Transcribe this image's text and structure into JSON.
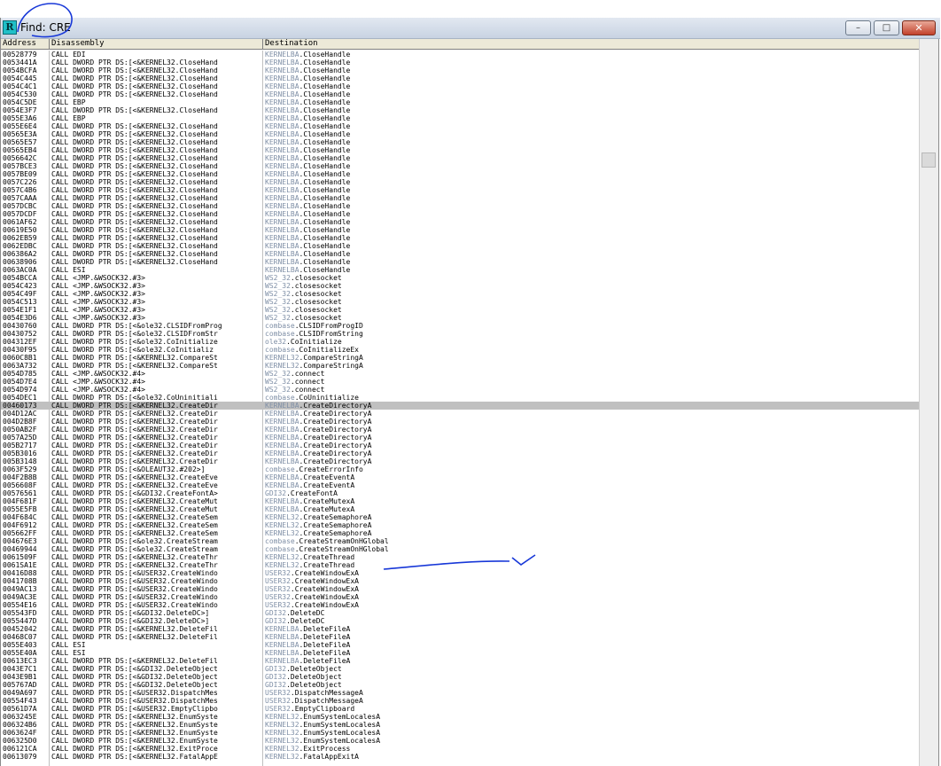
{
  "window": {
    "title": "Find: CRE",
    "app_icon_letter": "R",
    "controls": {
      "minimize": "–",
      "maximize": "□",
      "close": "✕"
    }
  },
  "columns": [
    "Address",
    "Disassembly",
    "Destination"
  ],
  "selected_row": 44,
  "rows": [
    {
      "addr": "00528779",
      "dis": "CALL EDI",
      "mod": "KERNELBA",
      "fn": ".CloseHandle"
    },
    {
      "addr": "0053441A",
      "dis": "CALL DWORD PTR DS:[<&KERNEL32.CloseHand",
      "mod": "KERNELBA",
      "fn": ".CloseHandle"
    },
    {
      "addr": "0054BCFA",
      "dis": "CALL DWORD PTR DS:[<&KERNEL32.CloseHand",
      "mod": "KERNELBA",
      "fn": ".CloseHandle"
    },
    {
      "addr": "0054C445",
      "dis": "CALL DWORD PTR DS:[<&KERNEL32.CloseHand",
      "mod": "KERNELBA",
      "fn": ".CloseHandle"
    },
    {
      "addr": "0054C4C1",
      "dis": "CALL DWORD PTR DS:[<&KERNEL32.CloseHand",
      "mod": "KERNELBA",
      "fn": ".CloseHandle"
    },
    {
      "addr": "0054C530",
      "dis": "CALL DWORD PTR DS:[<&KERNEL32.CloseHand",
      "mod": "KERNELBA",
      "fn": ".CloseHandle"
    },
    {
      "addr": "0054C5DE",
      "dis": "CALL EBP",
      "mod": "KERNELBA",
      "fn": ".CloseHandle"
    },
    {
      "addr": "0054E3F7",
      "dis": "CALL DWORD PTR DS:[<&KERNEL32.CloseHand",
      "mod": "KERNELBA",
      "fn": ".CloseHandle"
    },
    {
      "addr": "0055E3A6",
      "dis": "CALL EBP",
      "mod": "KERNELBA",
      "fn": ".CloseHandle"
    },
    {
      "addr": "0055E6E4",
      "dis": "CALL DWORD PTR DS:[<&KERNEL32.CloseHand",
      "mod": "KERNELBA",
      "fn": ".CloseHandle"
    },
    {
      "addr": "00565E3A",
      "dis": "CALL DWORD PTR DS:[<&KERNEL32.CloseHand",
      "mod": "KERNELBA",
      "fn": ".CloseHandle"
    },
    {
      "addr": "00565E57",
      "dis": "CALL DWORD PTR DS:[<&KERNEL32.CloseHand",
      "mod": "KERNELBA",
      "fn": ".CloseHandle"
    },
    {
      "addr": "00565EB4",
      "dis": "CALL DWORD PTR DS:[<&KERNEL32.CloseHand",
      "mod": "KERNELBA",
      "fn": ".CloseHandle"
    },
    {
      "addr": "0056642C",
      "dis": "CALL DWORD PTR DS:[<&KERNEL32.CloseHand",
      "mod": "KERNELBA",
      "fn": ".CloseHandle"
    },
    {
      "addr": "0057BCE3",
      "dis": "CALL DWORD PTR DS:[<&KERNEL32.CloseHand",
      "mod": "KERNELBA",
      "fn": ".CloseHandle"
    },
    {
      "addr": "0057BE09",
      "dis": "CALL DWORD PTR DS:[<&KERNEL32.CloseHand",
      "mod": "KERNELBA",
      "fn": ".CloseHandle"
    },
    {
      "addr": "0057C226",
      "dis": "CALL DWORD PTR DS:[<&KERNEL32.CloseHand",
      "mod": "KERNELBA",
      "fn": ".CloseHandle"
    },
    {
      "addr": "0057C4B6",
      "dis": "CALL DWORD PTR DS:[<&KERNEL32.CloseHand",
      "mod": "KERNELBA",
      "fn": ".CloseHandle"
    },
    {
      "addr": "0057CAAA",
      "dis": "CALL DWORD PTR DS:[<&KERNEL32.CloseHand",
      "mod": "KERNELBA",
      "fn": ".CloseHandle"
    },
    {
      "addr": "0057DCBC",
      "dis": "CALL DWORD PTR DS:[<&KERNEL32.CloseHand",
      "mod": "KERNELBA",
      "fn": ".CloseHandle"
    },
    {
      "addr": "0057DCDF",
      "dis": "CALL DWORD PTR DS:[<&KERNEL32.CloseHand",
      "mod": "KERNELBA",
      "fn": ".CloseHandle"
    },
    {
      "addr": "0061AF62",
      "dis": "CALL DWORD PTR DS:[<&KERNEL32.CloseHand",
      "mod": "KERNELBA",
      "fn": ".CloseHandle"
    },
    {
      "addr": "00619E50",
      "dis": "CALL DWORD PTR DS:[<&KERNEL32.CloseHand",
      "mod": "KERNELBA",
      "fn": ".CloseHandle"
    },
    {
      "addr": "0062EB59",
      "dis": "CALL DWORD PTR DS:[<&KERNEL32.CloseHand",
      "mod": "KERNELBA",
      "fn": ".CloseHandle"
    },
    {
      "addr": "0062EDBC",
      "dis": "CALL DWORD PTR DS:[<&KERNEL32.CloseHand",
      "mod": "KERNELBA",
      "fn": ".CloseHandle"
    },
    {
      "addr": "006386A2",
      "dis": "CALL DWORD PTR DS:[<&KERNEL32.CloseHand",
      "mod": "KERNELBA",
      "fn": ".CloseHandle"
    },
    {
      "addr": "00638906",
      "dis": "CALL DWORD PTR DS:[<&KERNEL32.CloseHand",
      "mod": "KERNELBA",
      "fn": ".CloseHandle"
    },
    {
      "addr": "0063AC0A",
      "dis": "CALL ESI",
      "mod": "KERNELBA",
      "fn": ".CloseHandle"
    },
    {
      "addr": "0054BCCA",
      "dis": "CALL <JMP.&WSOCK32.#3>",
      "mod": "WS2_32",
      "fn": ".closesocket"
    },
    {
      "addr": "0054C423",
      "dis": "CALL <JMP.&WSOCK32.#3>",
      "mod": "WS2_32",
      "fn": ".closesocket"
    },
    {
      "addr": "0054C49F",
      "dis": "CALL <JMP.&WSOCK32.#3>",
      "mod": "WS2_32",
      "fn": ".closesocket"
    },
    {
      "addr": "0054C513",
      "dis": "CALL <JMP.&WSOCK32.#3>",
      "mod": "WS2_32",
      "fn": ".closesocket"
    },
    {
      "addr": "0054E1F1",
      "dis": "CALL <JMP.&WSOCK32.#3>",
      "mod": "WS2_32",
      "fn": ".closesocket"
    },
    {
      "addr": "0054E3D6",
      "dis": "CALL <JMP.&WSOCK32.#3>",
      "mod": "WS2_32",
      "fn": ".closesocket"
    },
    {
      "addr": "00430760",
      "dis": "CALL DWORD PTR DS:[<&ole32.CLSIDFromProg",
      "mod": "combase",
      "fn": ".CLSIDFromProgID"
    },
    {
      "addr": "00430752",
      "dis": "CALL DWORD PTR DS:[<&ole32.CLSIDFromStr",
      "mod": "combase",
      "fn": ".CLSIDFromString"
    },
    {
      "addr": "004312EF",
      "dis": "CALL DWORD PTR DS:[<&ole32.CoInitialize",
      "mod": "ole32",
      "fn": ".CoInitialize"
    },
    {
      "addr": "00430F95",
      "dis": "CALL DWORD PTR DS:[<&ole32.CoInitializ",
      "mod": "combase",
      "fn": ".CoInitializeEx"
    },
    {
      "addr": "0060C8B1",
      "dis": "CALL DWORD PTR DS:[<&KERNEL32.CompareSt",
      "mod": "KERNEL32",
      "fn": ".CompareStringA"
    },
    {
      "addr": "0063A732",
      "dis": "CALL DWORD PTR DS:[<&KERNEL32.CompareSt",
      "mod": "KERNEL32",
      "fn": ".CompareStringA"
    },
    {
      "addr": "0054D785",
      "dis": "CALL <JMP.&WSOCK32.#4>",
      "mod": "WS2_32",
      "fn": ".connect"
    },
    {
      "addr": "0054D7E4",
      "dis": "CALL <JMP.&WSOCK32.#4>",
      "mod": "WS2_32",
      "fn": ".connect"
    },
    {
      "addr": "0054D974",
      "dis": "CALL <JMP.&WSOCK32.#4>",
      "mod": "WS2_32",
      "fn": ".connect"
    },
    {
      "addr": "0054DEC1",
      "dis": "CALL DWORD PTR DS:[<&ole32.CoUninitiali",
      "mod": "combase",
      "fn": ".CoUninitialize"
    },
    {
      "addr": "00460173",
      "dis": "CALL DWORD PTR DS:[<&KERNEL32.CreateDir",
      "mod": "KERNELBA",
      "fn": ".CreateDirectoryA"
    },
    {
      "addr": "004D12AC",
      "dis": "CALL DWORD PTR DS:[<&KERNEL32.CreateDir",
      "mod": "KERNELBA",
      "fn": ".CreateDirectoryA"
    },
    {
      "addr": "004D2B8F",
      "dis": "CALL DWORD PTR DS:[<&KERNEL32.CreateDir",
      "mod": "KERNELBA",
      "fn": ".CreateDirectoryA"
    },
    {
      "addr": "0050AB2F",
      "dis": "CALL DWORD PTR DS:[<&KERNEL32.CreateDir",
      "mod": "KERNELBA",
      "fn": ".CreateDirectoryA"
    },
    {
      "addr": "0057A25D",
      "dis": "CALL DWORD PTR DS:[<&KERNEL32.CreateDir",
      "mod": "KERNELBA",
      "fn": ".CreateDirectoryA"
    },
    {
      "addr": "005B2717",
      "dis": "CALL DWORD PTR DS:[<&KERNEL32.CreateDir",
      "mod": "KERNELBA",
      "fn": ".CreateDirectoryA"
    },
    {
      "addr": "005B3016",
      "dis": "CALL DWORD PTR DS:[<&KERNEL32.CreateDir",
      "mod": "KERNELBA",
      "fn": ".CreateDirectoryA"
    },
    {
      "addr": "005B3148",
      "dis": "CALL DWORD PTR DS:[<&KERNEL32.CreateDir",
      "mod": "KERNELBA",
      "fn": ".CreateDirectoryA"
    },
    {
      "addr": "0063F529",
      "dis": "CALL DWORD PTR DS:[<&OLEAUT32.#202>]",
      "mod": "combase",
      "fn": ".CreateErrorInfo"
    },
    {
      "addr": "004F2B8B",
      "dis": "CALL DWORD PTR DS:[<&KERNEL32.CreateEve",
      "mod": "KERNELBA",
      "fn": ".CreateEventA"
    },
    {
      "addr": "0056608F",
      "dis": "CALL DWORD PTR DS:[<&KERNEL32.CreateEve",
      "mod": "KERNELBA",
      "fn": ".CreateEventA"
    },
    {
      "addr": "00576561",
      "dis": "CALL DWORD PTR DS:[<&GDI32.CreateFontA>",
      "mod": "GDI32",
      "fn": ".CreateFontA"
    },
    {
      "addr": "004F681F",
      "dis": "CALL DWORD PTR DS:[<&KERNEL32.CreateMut",
      "mod": "KERNELBA",
      "fn": ".CreateMutexA"
    },
    {
      "addr": "0055E5FB",
      "dis": "CALL DWORD PTR DS:[<&KERNEL32.CreateMut",
      "mod": "KERNELBA",
      "fn": ".CreateMutexA"
    },
    {
      "addr": "004F684C",
      "dis": "CALL DWORD PTR DS:[<&KERNEL32.CreateSem",
      "mod": "KERNEL32",
      "fn": ".CreateSemaphoreA"
    },
    {
      "addr": "004F6912",
      "dis": "CALL DWORD PTR DS:[<&KERNEL32.CreateSem",
      "mod": "KERNEL32",
      "fn": ".CreateSemaphoreA"
    },
    {
      "addr": "005662FF",
      "dis": "CALL DWORD PTR DS:[<&KERNEL32.CreateSem",
      "mod": "KERNEL32",
      "fn": ".CreateSemaphoreA"
    },
    {
      "addr": "004676E3",
      "dis": "CALL DWORD PTR DS:[<&ole32.CreateStream",
      "mod": "combase",
      "fn": ".CreateStreamOnHGlobal"
    },
    {
      "addr": "00469944",
      "dis": "CALL DWORD PTR DS:[<&ole32.CreateStream",
      "mod": "combase",
      "fn": ".CreateStreamOnHGlobal"
    },
    {
      "addr": "0061509F",
      "dis": "CALL DWORD PTR DS:[<&KERNEL32.CreateThr",
      "mod": "KERNEL32",
      "fn": ".CreateThread"
    },
    {
      "addr": "0061SA1E",
      "dis": "CALL DWORD PTR DS:[<&KERNEL32.CreateThr",
      "mod": "KERNEL32",
      "fn": ".CreateThread"
    },
    {
      "addr": "00416D88",
      "dis": "CALL DWORD PTR DS:[<&USER32.CreateWindo",
      "mod": "USER32",
      "fn": ".CreateWindowExA"
    },
    {
      "addr": "0041708B",
      "dis": "CALL DWORD PTR DS:[<&USER32.CreateWindo",
      "mod": "USER32",
      "fn": ".CreateWindowExA"
    },
    {
      "addr": "0049AC13",
      "dis": "CALL DWORD PTR DS:[<&USER32.CreateWindo",
      "mod": "USER32",
      "fn": ".CreateWindowExA"
    },
    {
      "addr": "0049AC3E",
      "dis": "CALL DWORD PTR DS:[<&USER32.CreateWindo",
      "mod": "USER32",
      "fn": ".CreateWindowExA"
    },
    {
      "addr": "00554E16",
      "dis": "CALL DWORD PTR DS:[<&USER32.CreateWindo",
      "mod": "USER32",
      "fn": ".CreateWindowExA"
    },
    {
      "addr": "005543FD",
      "dis": "CALL DWORD PTR DS:[<&GDI32.DeleteDC>]",
      "mod": "GDI32",
      "fn": ".DeleteDC"
    },
    {
      "addr": "0055447D",
      "dis": "CALL DWORD PTR DS:[<&GDI32.DeleteDC>]",
      "mod": "GDI32",
      "fn": ".DeleteDC"
    },
    {
      "addr": "00452042",
      "dis": "CALL DWORD PTR DS:[<&KERNEL32.DeleteFil",
      "mod": "KERNELBA",
      "fn": ".DeleteFileA"
    },
    {
      "addr": "00468C07",
      "dis": "CALL DWORD PTR DS:[<&KERNEL32.DeleteFil",
      "mod": "KERNELBA",
      "fn": ".DeleteFileA"
    },
    {
      "addr": "0055E403",
      "dis": "CALL ESI",
      "mod": "KERNELBA",
      "fn": ".DeleteFileA"
    },
    {
      "addr": "0055E40A",
      "dis": "CALL ESI",
      "mod": "KERNELBA",
      "fn": ".DeleteFileA"
    },
    {
      "addr": "00613EC3",
      "dis": "CALL DWORD PTR DS:[<&KERNEL32.DeleteFil",
      "mod": "KERNELBA",
      "fn": ".DeleteFileA"
    },
    {
      "addr": "0043E7C1",
      "dis": "CALL DWORD PTR DS:[<&GDI32.DeleteObject",
      "mod": "GDI32",
      "fn": ".DeleteObject"
    },
    {
      "addr": "0043E9B1",
      "dis": "CALL DWORD PTR DS:[<&GDI32.DeleteObject",
      "mod": "GDI32",
      "fn": ".DeleteObject"
    },
    {
      "addr": "005767AD",
      "dis": "CALL DWORD PTR DS:[<&GDI32.DeleteObject",
      "mod": "GDI32",
      "fn": ".DeleteObject"
    },
    {
      "addr": "0049A697",
      "dis": "CALL DWORD PTR DS:[<&USER32.DispatchMes",
      "mod": "USER32",
      "fn": ".DispatchMessageA"
    },
    {
      "addr": "00554F43",
      "dis": "CALL DWORD PTR DS:[<&USER32.DispatchMes",
      "mod": "USER32",
      "fn": ".DispatchMessageA"
    },
    {
      "addr": "00561D7A",
      "dis": "CALL DWORD PTR DS:[<&USER32.EmptyClipbo",
      "mod": "USER32",
      "fn": ".EmptyClipboard"
    },
    {
      "addr": "0063245E",
      "dis": "CALL DWORD PTR DS:[<&KERNEL32.EnumSyste",
      "mod": "KERNEL32",
      "fn": ".EnumSystemLocalesA"
    },
    {
      "addr": "006324B6",
      "dis": "CALL DWORD PTR DS:[<&KERNEL32.EnumSyste",
      "mod": "KERNEL32",
      "fn": ".EnumSystemLocalesA"
    },
    {
      "addr": "0063624F",
      "dis": "CALL DWORD PTR DS:[<&KERNEL32.EnumSyste",
      "mod": "KERNEL32",
      "fn": ".EnumSystemLocalesA"
    },
    {
      "addr": "006325D0",
      "dis": "CALL DWORD PTR DS:[<&KERNEL32.EnumSyste",
      "mod": "KERNEL32",
      "fn": ".EnumSystemLocalesA"
    },
    {
      "addr": "006121CA",
      "dis": "CALL DWORD PTR DS:[<&KERNEL32.ExitProce",
      "mod": "KERNEL32",
      "fn": ".ExitProcess"
    },
    {
      "addr": "00613079",
      "dis": "CALL DWORD PTR DS:[<&KERNEL32.FatalAppE",
      "mod": "KERNEL32",
      "fn": ".FatalAppExitA"
    }
  ]
}
